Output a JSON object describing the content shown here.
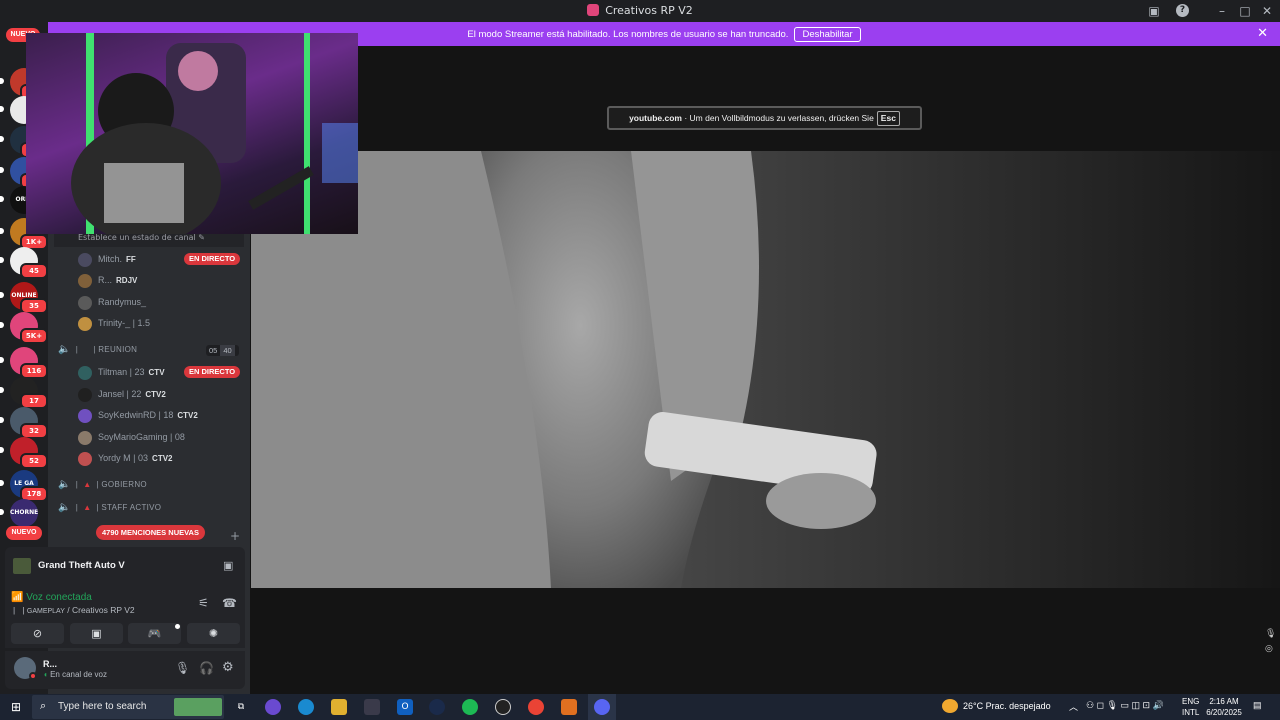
{
  "window": {
    "title": "Creativos RP V2"
  },
  "banner": {
    "message": "El modo Streamer está habilitado. Los nombres de usuario se han truncado.",
    "button": "Deshabilitar"
  },
  "rail": {
    "top_badge": "NUEVO",
    "bottom_badge": "NUEVO",
    "servers": [
      {
        "label": "",
        "badge": "1",
        "color": "#c0392b"
      },
      {
        "label": "",
        "badge": "",
        "color": "#e9e9e9"
      },
      {
        "label": "",
        "badge": "2",
        "color": "#203040"
      },
      {
        "label": "",
        "badge": "1",
        "color": "#3050a0"
      },
      {
        "label": "ORIG",
        "badge": "",
        "color": "#101010"
      },
      {
        "label": "",
        "badge": "1K+",
        "color": "#c07a20"
      },
      {
        "label": "",
        "badge": "45",
        "color": "#eeeeee"
      },
      {
        "label": "ONLINE",
        "badge": "35",
        "color": "#b01818"
      },
      {
        "label": "",
        "badge": "5K+",
        "color": "#e0457b"
      },
      {
        "label": "",
        "badge": "116",
        "color": "#e0457b"
      },
      {
        "label": "",
        "badge": "17",
        "color": "#222222"
      },
      {
        "label": "",
        "badge": "32",
        "color": "#4a5a6a"
      },
      {
        "label": "",
        "badge": "52",
        "color": "#c0202a"
      },
      {
        "label": "LE GA",
        "badge": "178",
        "color": "#1a3a80"
      },
      {
        "label": "CHORNE",
        "badge": "",
        "color": "#3a2a70"
      }
    ]
  },
  "channel": {
    "status_placeholder": "Establece un estado de canal",
    "live_label": "EN DIRECTO",
    "group1": [
      {
        "name": "Mitch.",
        "tag": "FF",
        "live": true,
        "color": "#4a4a60"
      },
      {
        "name": "R...",
        "tag": "RDJV",
        "live": false,
        "color": "#80603a"
      },
      {
        "name": "Randymus_",
        "tag": "",
        "live": false,
        "color": "#5a5a5a"
      },
      {
        "name": "Trinity-_ | 1.5",
        "tag": "",
        "live": false,
        "color": "#c09040"
      }
    ],
    "reunion": {
      "name": "REUNION",
      "count_a": "05",
      "count_b": "40"
    },
    "group2": [
      {
        "name": "Tiltman | 23",
        "tag": "CTV",
        "live": true,
        "color": "#306060"
      },
      {
        "name": "Jansel | 22",
        "tag": "CTV2",
        "live": false,
        "color": "#202020"
      },
      {
        "name": "SoyKedwinRD | 18",
        "tag": "CTV2",
        "live": false,
        "color": "#7050c0"
      },
      {
        "name": "SoyMarioGaming | 08",
        "tag": "",
        "live": false,
        "color": "#8a7a6a"
      },
      {
        "name": "Yordy M | 03",
        "tag": "CTV2",
        "live": false,
        "color": "#c05050"
      }
    ],
    "gobierno": "GOBIERNO",
    "staff": "STAFF ACTIVO",
    "mentions": "4790 MENCIONES NUEVAS"
  },
  "activity": {
    "game": "Grand Theft Auto V"
  },
  "voice": {
    "status": "Voz conectada",
    "channel_tag": "GAMEPLAY",
    "server": "/ Creativos RP V2"
  },
  "user": {
    "name": "R...",
    "status": "En canal de voz"
  },
  "video": {
    "domain": "youtube.com",
    "message": "Um den Vollbildmodus zu verlassen, drücken Sie",
    "key": "Esc"
  },
  "taskbar": {
    "search_placeholder": "Type here to search",
    "weather": "26°C  Prac. despejado",
    "lang_top": "ENG",
    "lang_bottom": "INTL",
    "time": "2:16 AM",
    "date": "6/20/2025"
  }
}
